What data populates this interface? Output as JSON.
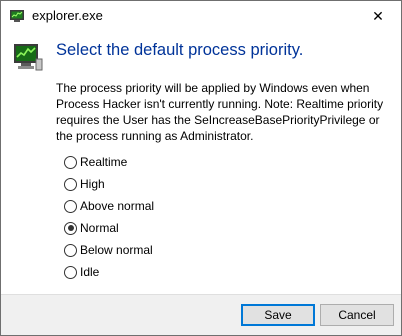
{
  "window": {
    "title": "explorer.exe",
    "close_glyph": "✕",
    "title_icon": "process-hacker-icon",
    "header_icon": "process-hacker-icon"
  },
  "dialog": {
    "main_instruction": "Select the default process priority.",
    "content": "The process priority will be applied by Windows even when Process Hacker isn't currently running. Note: Realtime priority requires the User has the SeIncreaseBasePriorityPrivilege or the process running as Administrator."
  },
  "priority_options": [
    {
      "label": "Realtime",
      "checked": false
    },
    {
      "label": "High",
      "checked": false
    },
    {
      "label": "Above normal",
      "checked": false
    },
    {
      "label": "Normal",
      "checked": true
    },
    {
      "label": "Below normal",
      "checked": false
    },
    {
      "label": "Idle",
      "checked": false
    }
  ],
  "buttons": {
    "save_label": "Save",
    "cancel_label": "Cancel"
  },
  "colors": {
    "instruction": "#003399",
    "accent": "#0078d7",
    "footer_bg": "#f0f0f0"
  }
}
